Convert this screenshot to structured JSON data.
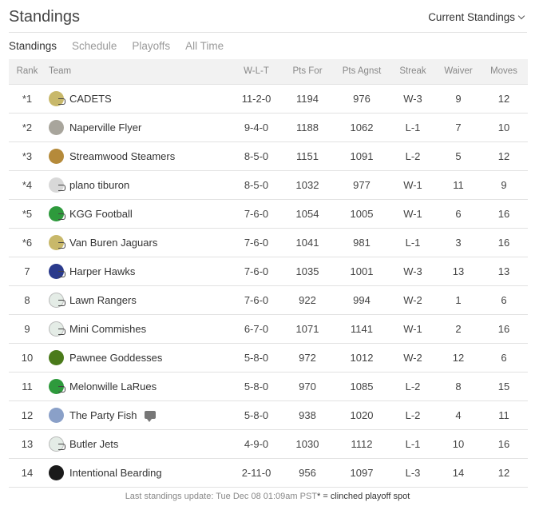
{
  "header": {
    "title": "Standings",
    "view_select": "Current Standings"
  },
  "tabs": [
    {
      "label": "Standings",
      "active": true
    },
    {
      "label": "Schedule",
      "active": false
    },
    {
      "label": "Playoffs",
      "active": false
    },
    {
      "label": "All Time",
      "active": false
    }
  ],
  "table": {
    "columns": [
      "Rank",
      "Team",
      "W-L-T",
      "Pts For",
      "Pts Agnst",
      "Streak",
      "Waiver",
      "Moves"
    ],
    "rows": [
      {
        "rank": "*1",
        "team": "CADETS",
        "logo": "helmet-gold",
        "logo_color": "#c8b86a",
        "wlt": "11-2-0",
        "pf": "1194",
        "pa": "976",
        "streak": "W-3",
        "waiver": "9",
        "moves": "12"
      },
      {
        "rank": "*2",
        "team": "Naperville Flyer",
        "logo": "photo-gray",
        "logo_color": "#a8a59c",
        "wlt": "9-4-0",
        "pf": "1188",
        "pa": "1062",
        "streak": "L-1",
        "waiver": "7",
        "moves": "10"
      },
      {
        "rank": "*3",
        "team": "Streamwood Steamers",
        "logo": "poop",
        "logo_color": "#b58a3a",
        "wlt": "8-5-0",
        "pf": "1151",
        "pa": "1091",
        "streak": "L-2",
        "waiver": "5",
        "moves": "12"
      },
      {
        "rank": "*4",
        "team": "plano tiburon",
        "logo": "helmet-gray",
        "logo_color": "#d8d8d8",
        "wlt": "8-5-0",
        "pf": "1032",
        "pa": "977",
        "streak": "W-1",
        "waiver": "11",
        "moves": "9"
      },
      {
        "rank": "*5",
        "team": "KGG Football",
        "logo": "helmet-green",
        "logo_color": "#2e9a3c",
        "wlt": "7-6-0",
        "pf": "1054",
        "pa": "1005",
        "streak": "W-1",
        "waiver": "6",
        "moves": "16"
      },
      {
        "rank": "*6",
        "team": "Van Buren Jaguars",
        "logo": "helmet-gold",
        "logo_color": "#c8b86a",
        "wlt": "7-6-0",
        "pf": "1041",
        "pa": "981",
        "streak": "L-1",
        "waiver": "3",
        "moves": "16"
      },
      {
        "rank": "7",
        "team": "Harper Hawks",
        "logo": "helmet-navy",
        "logo_color": "#2a3a8c",
        "wlt": "7-6-0",
        "pf": "1035",
        "pa": "1001",
        "streak": "W-3",
        "waiver": "13",
        "moves": "13"
      },
      {
        "rank": "8",
        "team": "Lawn Rangers",
        "logo": "helmet-white-green",
        "logo_color": "#e4ece6",
        "wlt": "7-6-0",
        "pf": "922",
        "pa": "994",
        "streak": "W-2",
        "waiver": "1",
        "moves": "6"
      },
      {
        "rank": "9",
        "team": "Mini Commishes",
        "logo": "helmet-white-green",
        "logo_color": "#e4ece6",
        "wlt": "6-7-0",
        "pf": "1071",
        "pa": "1141",
        "streak": "W-1",
        "waiver": "2",
        "moves": "16"
      },
      {
        "rank": "10",
        "team": "Pawnee Goddesses",
        "logo": "badge-green-gold",
        "logo_color": "#4a7a1a",
        "wlt": "5-8-0",
        "pf": "972",
        "pa": "1012",
        "streak": "W-2",
        "waiver": "12",
        "moves": "6"
      },
      {
        "rank": "11",
        "team": "Melonwille LaRues",
        "logo": "helmet-green",
        "logo_color": "#2e9a3c",
        "wlt": "5-8-0",
        "pf": "970",
        "pa": "1085",
        "streak": "L-2",
        "waiver": "8",
        "moves": "15"
      },
      {
        "rank": "12",
        "team": "The Party Fish",
        "logo": "photo-fish",
        "logo_color": "#8aa0c8",
        "has_comment": true,
        "wlt": "5-8-0",
        "pf": "938",
        "pa": "1020",
        "streak": "L-2",
        "waiver": "4",
        "moves": "11"
      },
      {
        "rank": "13",
        "team": "Butler Jets",
        "logo": "helmet-white-green",
        "logo_color": "#e4ece6",
        "wlt": "4-9-0",
        "pf": "1030",
        "pa": "1112",
        "streak": "L-1",
        "waiver": "10",
        "moves": "16"
      },
      {
        "rank": "14",
        "team": "Intentional Bearding",
        "logo": "photo-dark",
        "logo_color": "#1a1a1a",
        "wlt": "2-11-0",
        "pf": "956",
        "pa": "1097",
        "streak": "L-3",
        "waiver": "14",
        "moves": "12"
      }
    ]
  },
  "footer": {
    "update_text": "Last standings update: Tue Dec 08 01:09am PST",
    "legend_text": "* = clinched playoff spot"
  }
}
